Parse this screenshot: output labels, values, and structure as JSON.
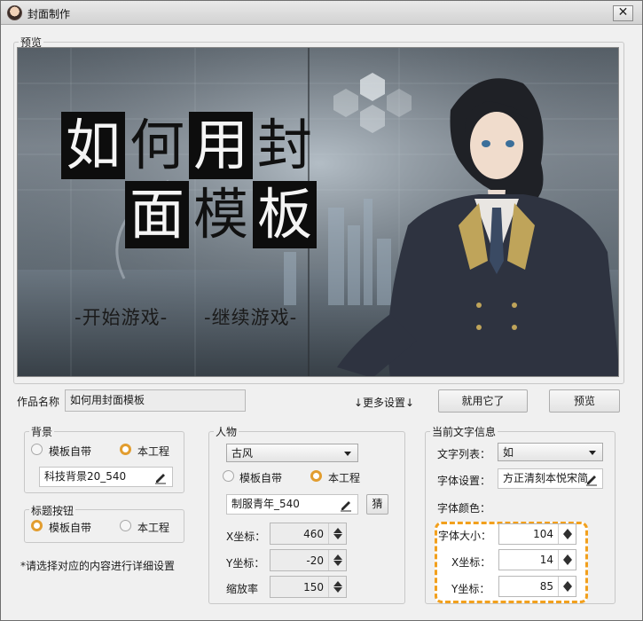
{
  "window": {
    "title": "封面制作",
    "close_glyph": "✕"
  },
  "preview": {
    "legend": "预览",
    "title_line1": [
      "如",
      "何",
      "用",
      "封"
    ],
    "title_line2": [
      "面",
      "模",
      "板"
    ],
    "menu_start": "-开始游戏-",
    "menu_continue": "-继续游戏-"
  },
  "work": {
    "name_label": "作品名称",
    "name_value": "如何用封面模板"
  },
  "actions": {
    "more_settings": "↓更多设置↓",
    "use_it": "就用它了",
    "preview": "预览"
  },
  "background": {
    "legend": "背景",
    "option_template": "模板自带",
    "option_project": "本工程",
    "selected": "option_project",
    "file": "科技背景20_540"
  },
  "title_button": {
    "legend": "标题按钮",
    "option_template": "模板自带",
    "option_project": "本工程",
    "selected": "option_template"
  },
  "hint": "*请选择对应的内容进行详细设置",
  "character": {
    "legend": "人物",
    "style": "古风",
    "option_template": "模板自带",
    "option_project": "本工程",
    "selected": "option_project",
    "file": "制服青年_540",
    "guess_button": "猜",
    "x_label": "X坐标：",
    "x_value": "460",
    "y_label": "Y坐标：",
    "y_value": "-20",
    "scale_label": "缩放率",
    "scale_value": "150"
  },
  "text_info": {
    "legend": "当前文字信息",
    "list_label": "文字列表：",
    "list_value": "如",
    "font_label": "字体设置：",
    "font_value": "方正清刻本悦宋简",
    "color_label": "字体颜色：",
    "size_label": "字体大小：",
    "size_value": "104",
    "x_label": "X坐标：",
    "x_value": "14",
    "y_label": "Y坐标：",
    "y_value": "85"
  },
  "colors": {
    "accent": "#f2a01d",
    "radio_checked": "#e29d2f"
  },
  "icons": {
    "pencil": "pencil-icon",
    "app": "app-avatar-icon"
  }
}
